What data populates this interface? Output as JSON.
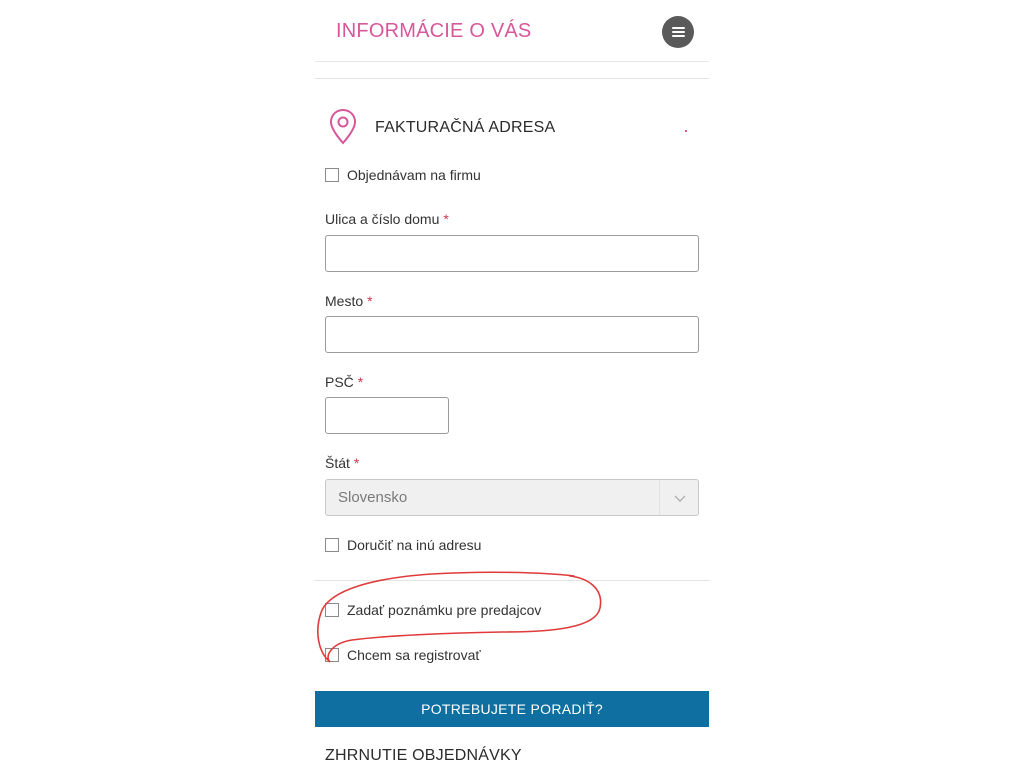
{
  "header": {
    "title": "INFORMÁCIE O VÁS",
    "menu_icon": "menu-icon"
  },
  "billing": {
    "section_icon": "map-pin-icon",
    "title": "FAKTURAČNÁ ADRESA",
    "company_checkbox_label": "Objednávam na firmu",
    "street_label": "Ulica a číslo domu",
    "city_label": "Mesto",
    "zip_label": "PSČ",
    "country_label": "Štát",
    "required_mark": "*",
    "street_value": "",
    "city_value": "",
    "zip_value": "",
    "country_value": "Slovensko",
    "ship_elsewhere_label": "Doručiť na inú adresu"
  },
  "extras": {
    "note_checkbox_label": "Zadať poznámku pre predajcov",
    "register_checkbox_label": "Chcem sa registrovať"
  },
  "help_button_label": "POTREBUJETE PORADIŤ?",
  "summary_title": "ZHRNUTIE OBJEDNÁVKY",
  "colors": {
    "accent_pink": "#d6589a",
    "button_blue": "#0e6fa0",
    "annotation_red": "#e03a3a"
  }
}
